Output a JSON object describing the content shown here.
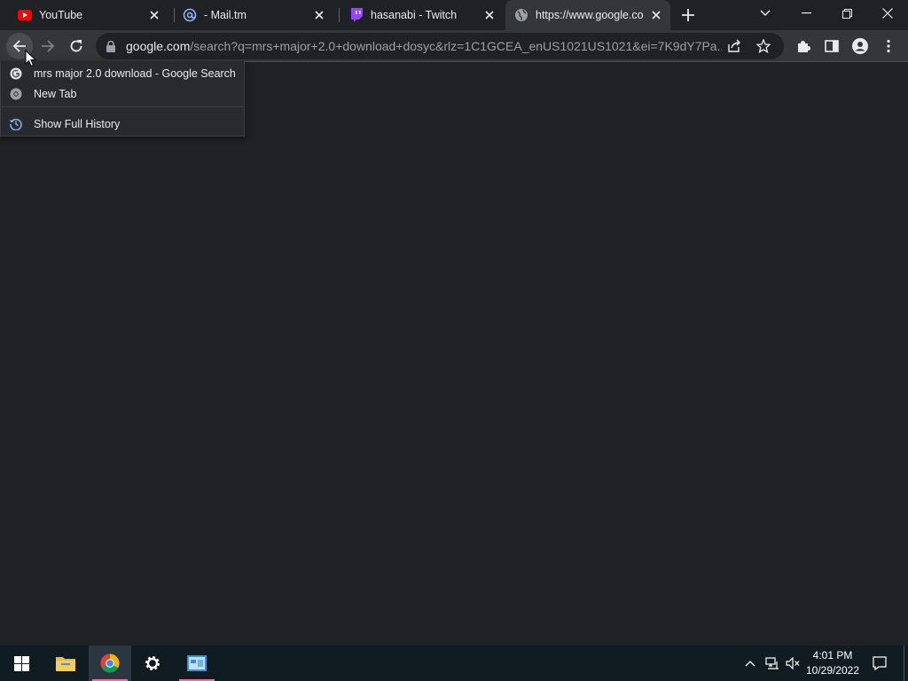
{
  "tabs": [
    {
      "title": "YouTube",
      "icon": "youtube-icon"
    },
    {
      "title": "- Mail.tm",
      "icon": "at-icon"
    },
    {
      "title": "hasanabi - Twitch",
      "icon": "twitch-icon"
    },
    {
      "title": "https://www.google.co",
      "icon": "globe-icon",
      "active": true
    }
  ],
  "omnibox": {
    "host": "google.com",
    "path": "/search?q=mrs+major+2.0+download+dosyc&rlz=1C1GCEA_enUS1021US1021&ei=7K9dY7Pa..."
  },
  "history_menu": {
    "items": [
      {
        "label": "mrs major 2.0 download - Google Search",
        "icon": "google-icon"
      },
      {
        "label": "New Tab",
        "icon": "chrome-icon"
      }
    ],
    "show_full_history": "Show Full History"
  },
  "taskbar": {
    "time": "4:01 PM",
    "date": "10/29/2022"
  },
  "colors": {
    "tab_active": "#35363a",
    "page_bg": "#202124",
    "taskbar_bg": "#111b22"
  }
}
